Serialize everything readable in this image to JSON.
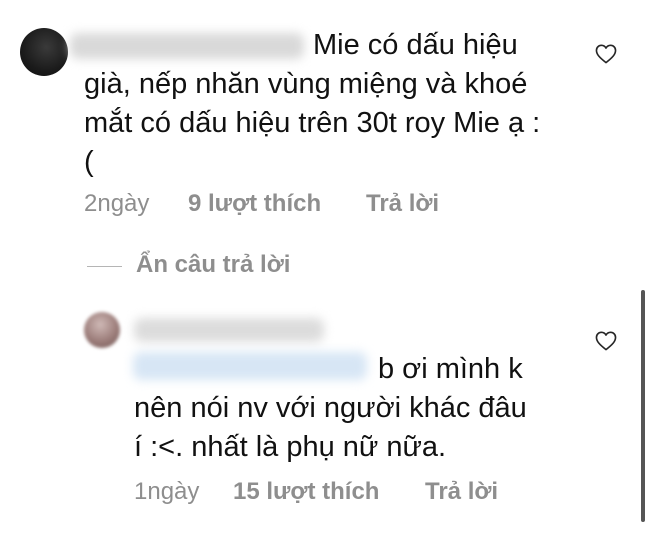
{
  "comment1": {
    "text_first_line": "Mie có dấu hiệu",
    "text_rest": "già, nếp nhăn vùng miệng và khoé\nmắt có dấu hiệu trên 30t roy Mie ạ :\n(",
    "time": "2ngày",
    "likes": "9 lượt thích",
    "reply": "Trả lời"
  },
  "replies_toggle": "Ẩn câu trả lời",
  "reply1": {
    "text_first_line": "b ơi mình k",
    "text_rest": "nên nói nv với người khác đâu\ní :<. nhất là phụ nữ nữa.",
    "time": "1ngày",
    "likes": "15 lượt thích",
    "reply": "Trả lời"
  },
  "colors": {
    "text": "#111111",
    "meta": "#8e8e8e",
    "background": "#ffffff"
  },
  "icons": {
    "like": "heart-outline-icon"
  }
}
